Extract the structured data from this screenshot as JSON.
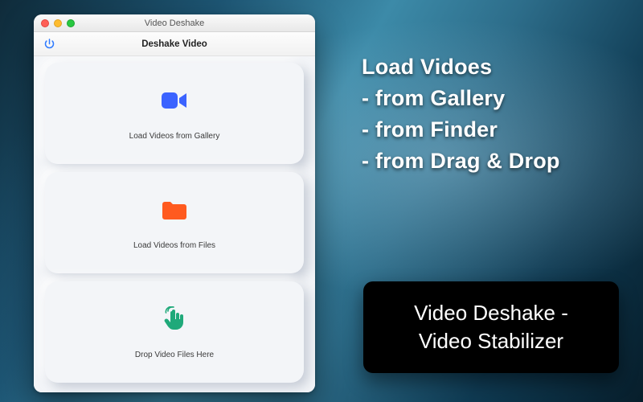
{
  "window": {
    "title": "Video Deshake",
    "toolbar_title": "Deshake Video"
  },
  "cards": {
    "gallery": {
      "label": "Load Videos from Gallery"
    },
    "files": {
      "label": "Load Videos from Files"
    },
    "drop": {
      "label": "Drop Video Files Here"
    }
  },
  "promo": {
    "line1": "Load Vidoes",
    "line2": "- from Gallery",
    "line3": "- from Finder",
    "line4": "- from Drag & Drop"
  },
  "product": {
    "line1": "Video Deshake -",
    "line2": "Video Stabilizer"
  },
  "colors": {
    "camera": "#3b63ff",
    "folder": "#ff5a1f",
    "hand": "#1fa97a",
    "power": "#2f7bff"
  }
}
